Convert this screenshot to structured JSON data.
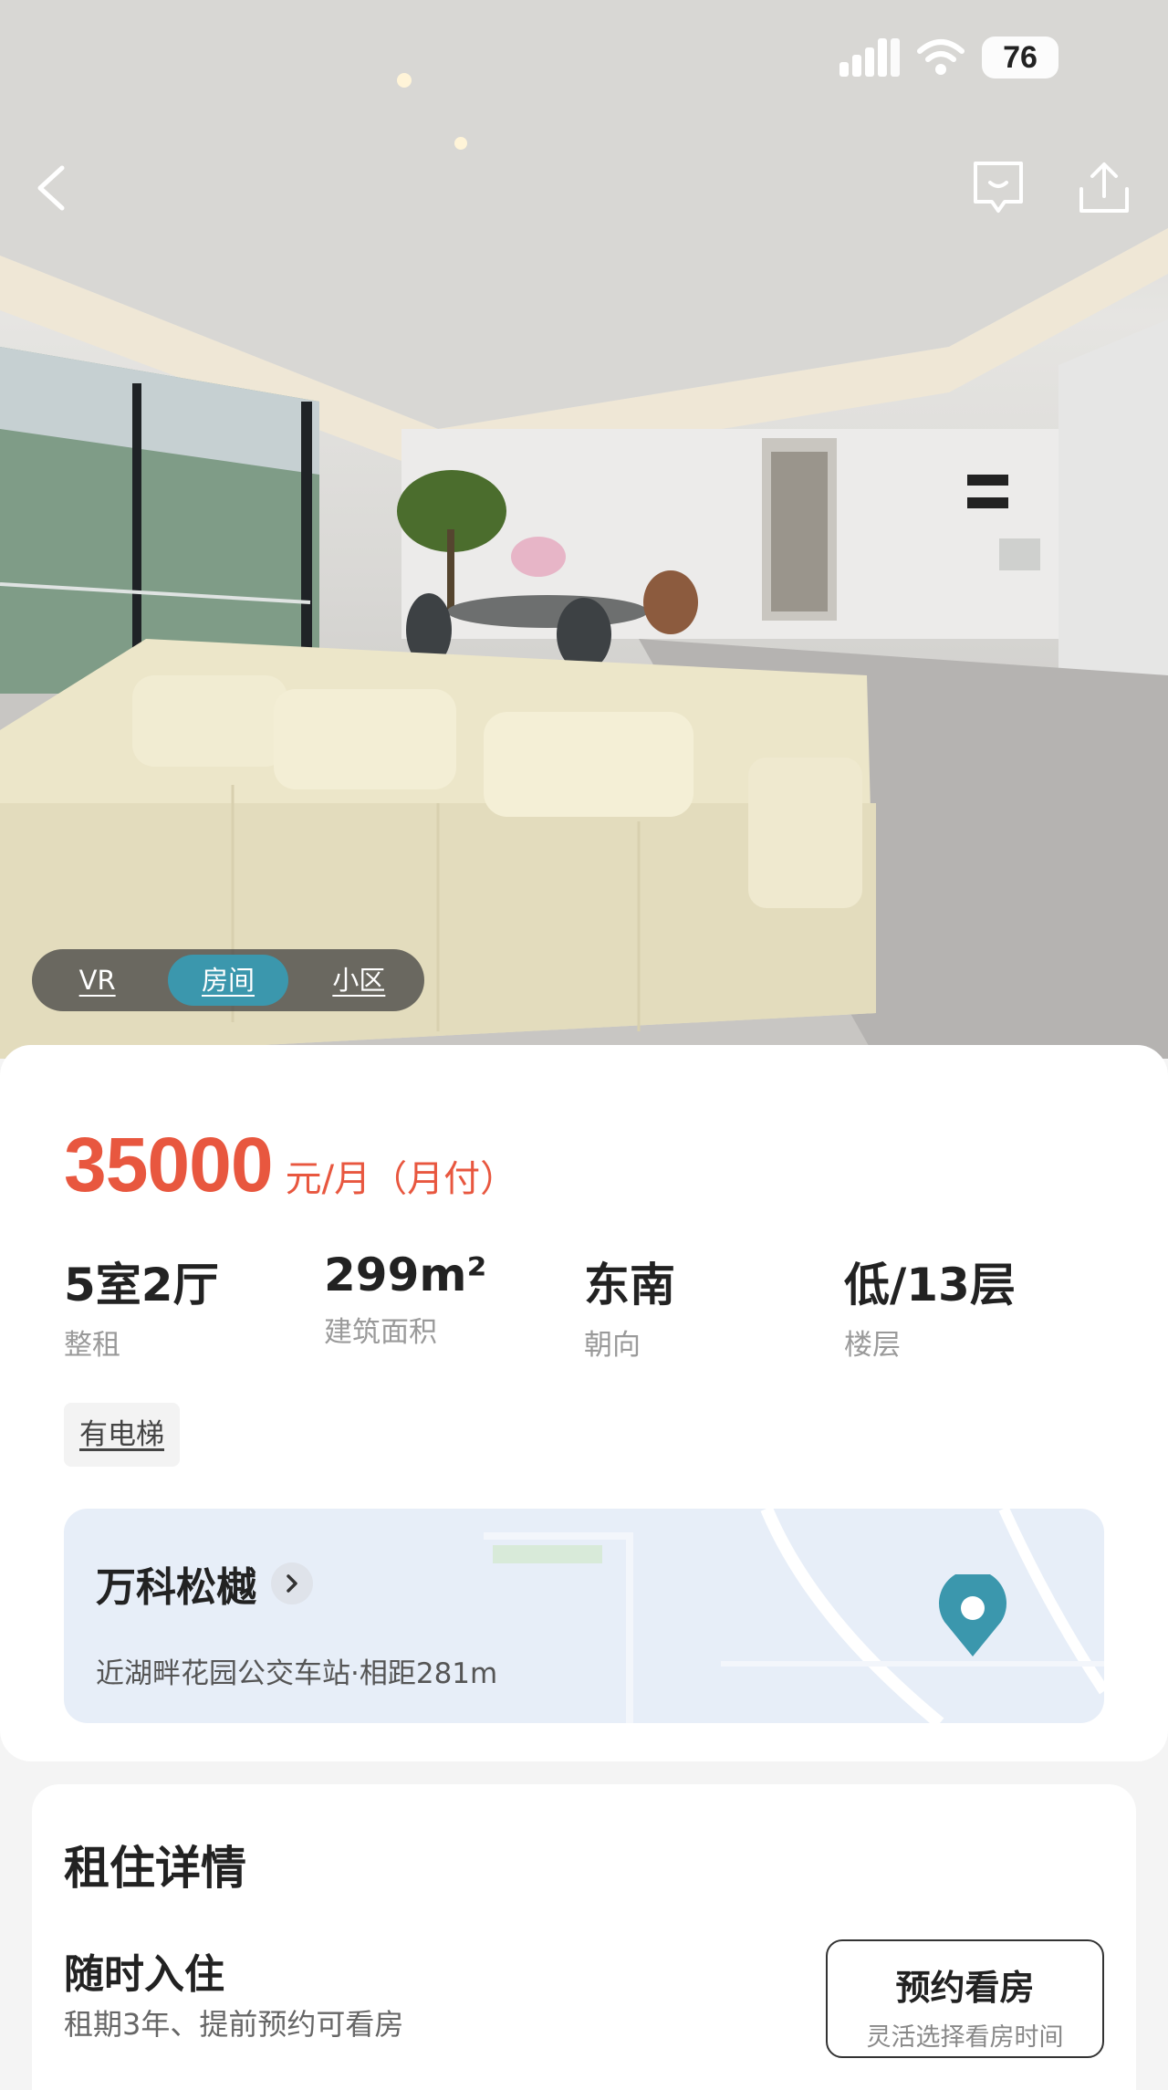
{
  "status_bar": {
    "battery": "76"
  },
  "hero": {
    "tabs": [
      {
        "label": "VR",
        "active": false
      },
      {
        "label": "房间",
        "active": true
      },
      {
        "label": "小区",
        "active": false
      }
    ]
  },
  "listing": {
    "price": "35000",
    "price_unit": "元/月（月付）",
    "stats": [
      {
        "value": "5室2厅",
        "label": "整租"
      },
      {
        "value": "299m²",
        "label": "建筑面积"
      },
      {
        "value": "东南",
        "label": "朝向"
      },
      {
        "value": "低/13层",
        "label": "楼层"
      }
    ],
    "tags": [
      "有电梯"
    ],
    "community": {
      "name": "万科松樾",
      "transit": "近湖畔花园公交车站·相距281m"
    }
  },
  "rental_details": {
    "title": "租住详情",
    "move_in": "随时入住",
    "lease_info": "租期3年、提前预约可看房",
    "booking": {
      "title": "预约看房",
      "subtitle": "灵活选择看房时间"
    }
  },
  "colors": {
    "accent": "#3b97ad",
    "price": "#e8573f"
  }
}
